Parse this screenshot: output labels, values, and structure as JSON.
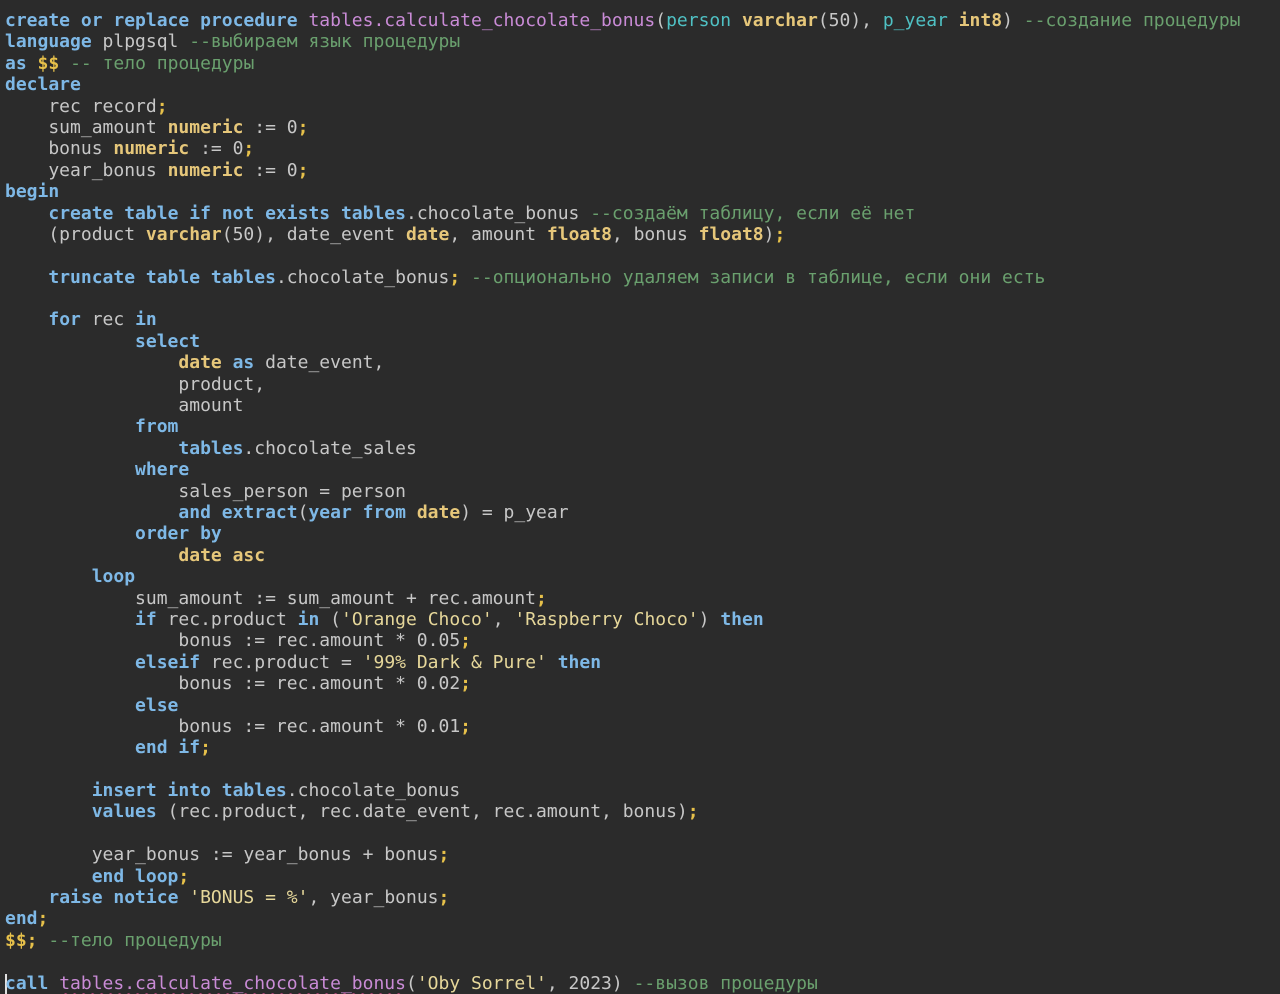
{
  "editor": {
    "lines": [
      [
        [
          "kw",
          "create or replace procedure"
        ],
        [
          "pl",
          " "
        ],
        [
          "fn",
          "tables.calculate_chocolate_bonus"
        ],
        [
          "pl",
          "("
        ],
        [
          "pa",
          "person"
        ],
        [
          "pl",
          " "
        ],
        [
          "ty",
          "varchar"
        ],
        [
          "pl",
          "(50), "
        ],
        [
          "pa",
          "p_year"
        ],
        [
          "pl",
          " "
        ],
        [
          "ty",
          "int8"
        ],
        [
          "pl",
          ") "
        ],
        [
          "cm",
          "--создание процедуры"
        ]
      ],
      [
        [
          "kw",
          "language"
        ],
        [
          "pl",
          " plpgsql "
        ],
        [
          "cm",
          "--выбираем язык процедуры"
        ]
      ],
      [
        [
          "kw",
          "as"
        ],
        [
          "pl",
          " "
        ],
        [
          "sc",
          "$$"
        ],
        [
          "pl",
          " "
        ],
        [
          "cm",
          "-- тело процедуры"
        ]
      ],
      [
        [
          "kw",
          "declare"
        ]
      ],
      [
        [
          "pl",
          "    rec record"
        ],
        [
          "sc",
          ";"
        ]
      ],
      [
        [
          "pl",
          "    sum_amount "
        ],
        [
          "ty",
          "numeric"
        ],
        [
          "pl",
          " := 0"
        ],
        [
          "sc",
          ";"
        ]
      ],
      [
        [
          "pl",
          "    bonus "
        ],
        [
          "ty",
          "numeric"
        ],
        [
          "pl",
          " := 0"
        ],
        [
          "sc",
          ";"
        ]
      ],
      [
        [
          "pl",
          "    year_bonus "
        ],
        [
          "ty",
          "numeric"
        ],
        [
          "pl",
          " := 0"
        ],
        [
          "sc",
          ";"
        ]
      ],
      [
        [
          "kw",
          "begin"
        ]
      ],
      [
        [
          "pl",
          "    "
        ],
        [
          "kw",
          "create table if not exists tables"
        ],
        [
          "pl",
          ".chocolate_bonus "
        ],
        [
          "cm",
          "--создаём таблицу, если её нет"
        ]
      ],
      [
        [
          "pl",
          "    (product "
        ],
        [
          "ty",
          "varchar"
        ],
        [
          "pl",
          "(50), date_event "
        ],
        [
          "ty",
          "date"
        ],
        [
          "pl",
          ", amount "
        ],
        [
          "ty",
          "float8"
        ],
        [
          "pl",
          ", bonus "
        ],
        [
          "ty",
          "float8"
        ],
        [
          "pl",
          ")"
        ],
        [
          "sc",
          ";"
        ]
      ],
      [],
      [
        [
          "pl",
          "    "
        ],
        [
          "kw",
          "truncate table tables"
        ],
        [
          "pl",
          ".chocolate_bonus"
        ],
        [
          "sc",
          ";"
        ],
        [
          "pl",
          " "
        ],
        [
          "cm",
          "--опционально удаляем записи в таблице, если они есть"
        ]
      ],
      [],
      [
        [
          "pl",
          "    "
        ],
        [
          "kw",
          "for"
        ],
        [
          "pl",
          " rec "
        ],
        [
          "kw",
          "in"
        ]
      ],
      [
        [
          "pl",
          "            "
        ],
        [
          "kw",
          "select"
        ]
      ],
      [
        [
          "pl",
          "                "
        ],
        [
          "ty",
          "date"
        ],
        [
          "pl",
          " "
        ],
        [
          "kw",
          "as"
        ],
        [
          "pl",
          " date_event,"
        ]
      ],
      [
        [
          "pl",
          "                product,"
        ]
      ],
      [
        [
          "pl",
          "                amount"
        ]
      ],
      [
        [
          "pl",
          "            "
        ],
        [
          "kw",
          "from"
        ]
      ],
      [
        [
          "pl",
          "                "
        ],
        [
          "kw",
          "tables"
        ],
        [
          "pl",
          ".chocolate_sales"
        ]
      ],
      [
        [
          "pl",
          "            "
        ],
        [
          "kw",
          "where"
        ]
      ],
      [
        [
          "pl",
          "                sales_person = person"
        ]
      ],
      [
        [
          "pl",
          "                "
        ],
        [
          "kw",
          "and extract"
        ],
        [
          "pl",
          "("
        ],
        [
          "kw",
          "year from"
        ],
        [
          "pl",
          " "
        ],
        [
          "ty",
          "date"
        ],
        [
          "pl",
          ") = p_year"
        ]
      ],
      [
        [
          "pl",
          "            "
        ],
        [
          "kw",
          "order by"
        ]
      ],
      [
        [
          "pl",
          "                "
        ],
        [
          "ty",
          "date asc"
        ]
      ],
      [
        [
          "pl",
          "        "
        ],
        [
          "kw",
          "loop"
        ]
      ],
      [
        [
          "pl",
          "            sum_amount := sum_amount + rec.amount"
        ],
        [
          "sc",
          ";"
        ]
      ],
      [
        [
          "pl",
          "            "
        ],
        [
          "kw",
          "if"
        ],
        [
          "pl",
          " rec.product "
        ],
        [
          "kw",
          "in"
        ],
        [
          "pl",
          " ("
        ],
        [
          "st",
          "'Orange Choco'"
        ],
        [
          "pl",
          ", "
        ],
        [
          "st",
          "'Raspberry Choco'"
        ],
        [
          "pl",
          ") "
        ],
        [
          "kw",
          "then"
        ]
      ],
      [
        [
          "pl",
          "                bonus := rec.amount * 0.05"
        ],
        [
          "sc",
          ";"
        ]
      ],
      [
        [
          "pl",
          "            "
        ],
        [
          "kw",
          "elseif"
        ],
        [
          "pl",
          " rec.product = "
        ],
        [
          "st",
          "'99% Dark & Pure'"
        ],
        [
          "pl",
          " "
        ],
        [
          "kw",
          "then"
        ]
      ],
      [
        [
          "pl",
          "                bonus := rec.amount * 0.02"
        ],
        [
          "sc",
          ";"
        ]
      ],
      [
        [
          "pl",
          "            "
        ],
        [
          "kw",
          "else"
        ]
      ],
      [
        [
          "pl",
          "                bonus := rec.amount * 0.01"
        ],
        [
          "sc",
          ";"
        ]
      ],
      [
        [
          "pl",
          "            "
        ],
        [
          "kw",
          "end if"
        ],
        [
          "sc",
          ";"
        ]
      ],
      [],
      [
        [
          "pl",
          "        "
        ],
        [
          "kw",
          "insert into tables"
        ],
        [
          "pl",
          ".chocolate_bonus"
        ]
      ],
      [
        [
          "pl",
          "        "
        ],
        [
          "kw",
          "values"
        ],
        [
          "pl",
          " (rec.product, rec.date_event, rec.amount, bonus)"
        ],
        [
          "sc",
          ";"
        ]
      ],
      [],
      [
        [
          "pl",
          "        year_bonus := year_bonus + bonus"
        ],
        [
          "sc",
          ";"
        ]
      ],
      [
        [
          "pl",
          "        "
        ],
        [
          "kw",
          "end loop"
        ],
        [
          "sc",
          ";"
        ]
      ],
      [
        [
          "pl",
          "    "
        ],
        [
          "kw",
          "raise notice"
        ],
        [
          "pl",
          " "
        ],
        [
          "st",
          "'BONUS = %'"
        ],
        [
          "pl",
          ", year_bonus"
        ],
        [
          "sc",
          ";"
        ]
      ],
      [
        [
          "kw",
          "end"
        ],
        [
          "sc",
          ";"
        ]
      ],
      [
        [
          "sc",
          "$$;"
        ],
        [
          "pl",
          " "
        ],
        [
          "cm",
          "--тело процедуры"
        ]
      ],
      [],
      [
        [
          "kw",
          "call"
        ],
        [
          "pl",
          " "
        ],
        [
          "fn",
          "tables.calculate_chocolate_bonus"
        ],
        [
          "pl",
          "("
        ],
        [
          "st",
          "'Oby Sorrel'"
        ],
        [
          "pl",
          ", 2023) "
        ],
        [
          "cm",
          "--вызов процедуры"
        ]
      ]
    ]
  }
}
